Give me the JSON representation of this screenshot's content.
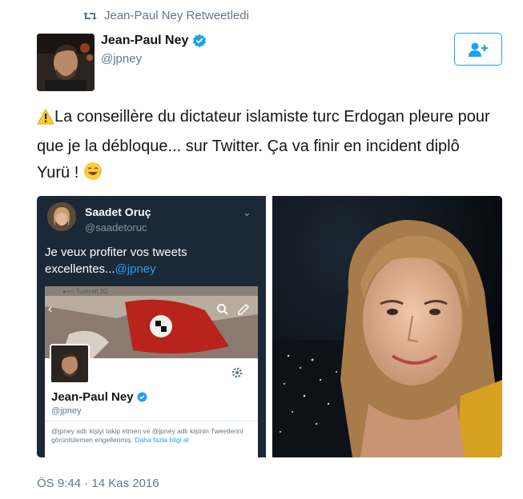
{
  "retweet": {
    "label": "Jean-Paul Ney Retweetledi",
    "icon": "retweet-icon"
  },
  "author": {
    "name": "Jean-Paul Ney",
    "handle": "@jpney",
    "verified": true,
    "avatar_icon": "avatar"
  },
  "follow_button": {
    "icon": "add-user-icon"
  },
  "tweet": {
    "line_1": "La conseillère du dictateur islamiste turc Erdogan pleure pour",
    "line_2": "que je la débloque... sur Twitter. Ça va finir en incident diplô",
    "line_3": "Yurü !",
    "leading_emoji": "warning-icon",
    "trailing_emoji": "tears-of-joy-icon"
  },
  "embedded_screenshot": {
    "author_name": "Saadet Oruç",
    "author_handle": "@saadetoruc",
    "text_line_1": "Je veux profiter vos tweets",
    "text_line_2": "excellentes...",
    "mention": "@jpney",
    "status_bar": "●○○ Turkcell  3G",
    "profile": {
      "name": "Jean-Paul Ney",
      "handle": "@jpney",
      "blocked_notice": "@jpney adlı kişiyi takip etmen ve @jpney adlı kişinin Tweetlerini görüntülemen engellenmiş.",
      "learn_more": "Daha fazla bilgi al"
    }
  },
  "timestamp": "ÖS 9:44 · 14 Kas 2016",
  "colors": {
    "accent": "#1da1f2",
    "muted": "#657786",
    "text": "#14171a",
    "warning": "#ffcc33"
  }
}
